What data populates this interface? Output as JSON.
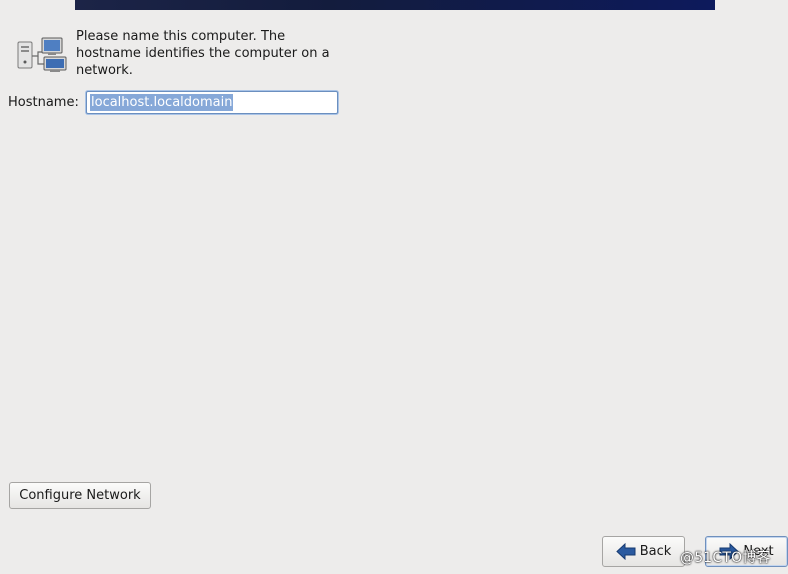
{
  "header": {
    "banner_color": "#131c3d"
  },
  "intro": {
    "icon": "network-computers-icon",
    "text": "Please name this computer.  The\nhostname identifies the computer on a\nnetwork."
  },
  "hostname": {
    "label": "Hostname:",
    "value": "localhost.localdomain"
  },
  "buttons": {
    "configure_network": "Configure Network",
    "back": "Back",
    "next": "Next"
  },
  "watermark": "@51CTO博客",
  "colors": {
    "background": "#edeceb",
    "arrow": "#2a5aa0",
    "selection": "#86a8d8"
  }
}
